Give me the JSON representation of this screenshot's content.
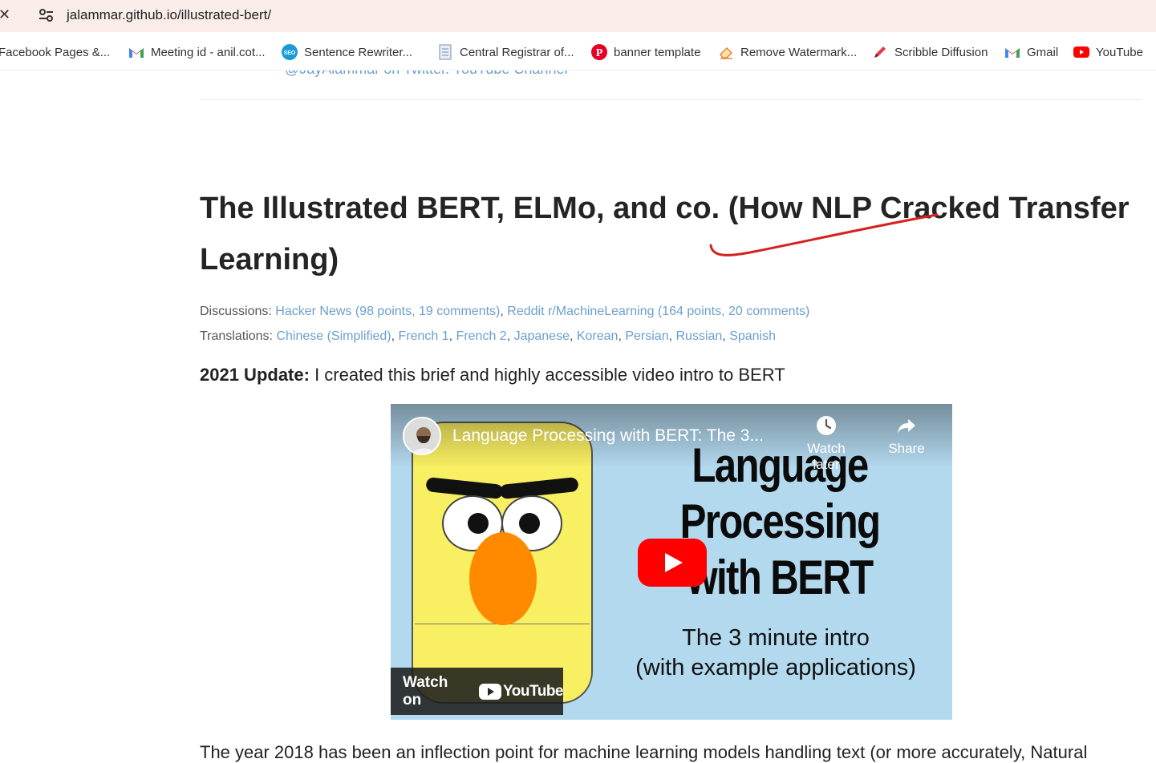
{
  "browser": {
    "url": "jalammar.github.io/illustrated-bert/",
    "bookmarks": [
      {
        "label": "Facebook Pages &...",
        "icon": "facebook-icon"
      },
      {
        "label": "Meeting id - anil.cot...",
        "icon": "gmail-icon"
      },
      {
        "label": "Sentence Rewriter...",
        "icon": "seo-icon"
      },
      {
        "label": "Central Registrar of...",
        "icon": "document-icon"
      },
      {
        "label": "banner template",
        "icon": "pinterest-icon"
      },
      {
        "label": "Remove Watermark...",
        "icon": "eraser-icon"
      },
      {
        "label": "Scribble Diffusion",
        "icon": "pencil-icon"
      },
      {
        "label": "Gmail",
        "icon": "gmail-icon"
      },
      {
        "label": "YouTube",
        "icon": "youtube-icon"
      }
    ]
  },
  "header": {
    "prev_links": "@JayAlammar on Twitter. YouTube Channel"
  },
  "article": {
    "title": "The Illustrated BERT, ELMo, and co. (How NLP Cracked Transfer Learning)",
    "discussions_label": "Discussions:",
    "discussions": [
      "Hacker News (98 points, 19 comments)",
      "Reddit r/MachineLearning (164 points, 20 comments)"
    ],
    "translations_label": "Translations:",
    "translations": [
      "Chinese (Simplified)",
      "French 1",
      "French 2",
      "Japanese",
      "Korean",
      "Persian",
      "Russian",
      "Spanish"
    ],
    "update_label": "2021 Update:",
    "update_text": " I created this brief and highly accessible video intro to BERT",
    "body_start": "The year 2018 has been an inflection point for machine learning models handling text (or more accurately, Natural"
  },
  "video": {
    "title": "Language Processing with BERT: The 3...",
    "watch_later": "Watch later",
    "share": "Share",
    "thumb_title": "Language Processing with BERT",
    "thumb_sub_1": "The 3 minute intro",
    "thumb_sub_2": "(with example applications)",
    "watch_on": "Watch on",
    "youtube": "YouTube"
  },
  "colors": {
    "link": "#6a9fd0",
    "annotation": "#d62020",
    "bert_yellow": "#f9ef62",
    "bert_nose": "#ff8a00",
    "video_bg": "#b3d9ef"
  }
}
